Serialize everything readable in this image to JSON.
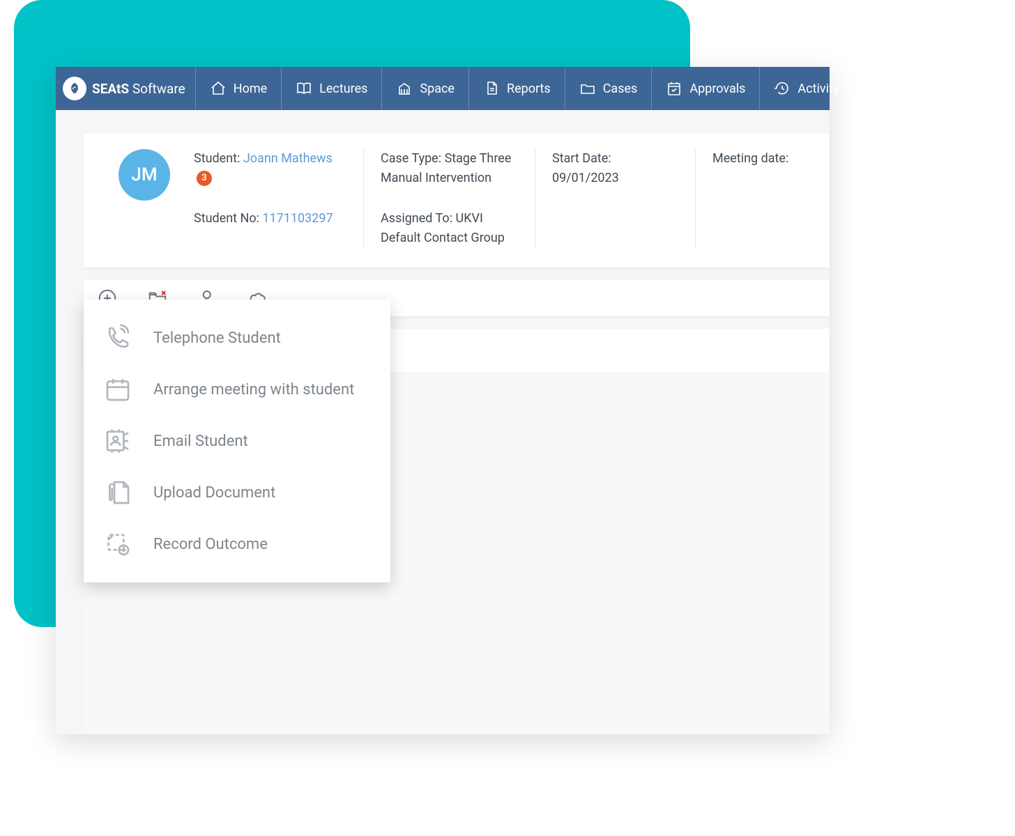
{
  "brand": {
    "name_bold": "SEAtS",
    "name_rest": " Software"
  },
  "nav": {
    "home": "Home",
    "lectures": "Lectures",
    "space": "Space",
    "reports": "Reports",
    "cases": "Cases",
    "approvals": "Approvals",
    "activity": "Activity"
  },
  "student": {
    "avatar_initials": "JM",
    "label": "Student: ",
    "name": "Joann Mathews",
    "badge_count": "3",
    "no_label": "Student No: ",
    "no_value": "1171103297"
  },
  "case": {
    "type_label": "Case Type: ",
    "type_value": "Stage Three Manual Intervention",
    "assigned_label": "Assigned To: ",
    "assigned_value": "UKVI Default Contact Group",
    "start_label": "Start Date:",
    "start_value": "09/01/2023",
    "meeting_label": "Meeting date:",
    "meeting_value": ""
  },
  "menu": {
    "telephone": "Telephone Student",
    "meeting": "Arrange meeting with student",
    "email": "Email Student",
    "upload": "Upload Document",
    "outcome": "Record Outcome"
  }
}
